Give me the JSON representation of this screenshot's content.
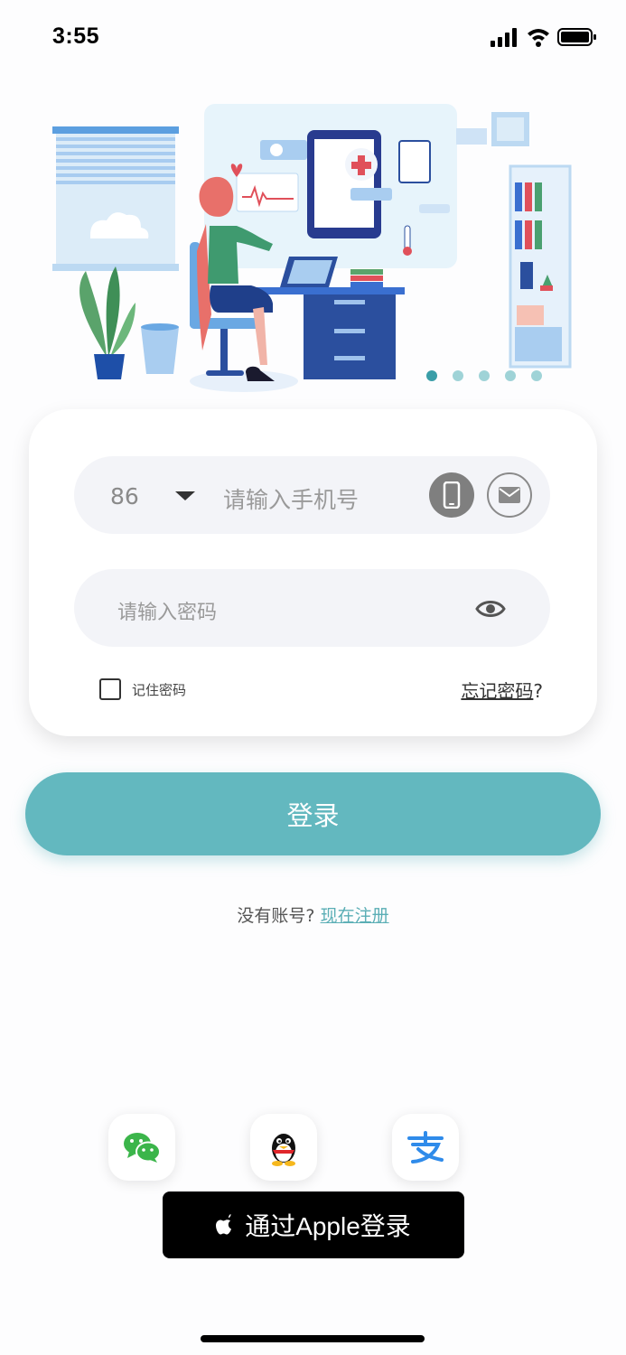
{
  "status_bar": {
    "time": "3:55",
    "icons": [
      "signal-icon",
      "wifi-icon",
      "battery-icon"
    ]
  },
  "hero": {
    "carousel_total": 5,
    "carousel_active": 1
  },
  "login_form": {
    "country_code": "86",
    "phone_placeholder": "请输入手机号",
    "password_placeholder": "请输入密码",
    "remember_label": "记住密码",
    "forgot_label": "忘记密码",
    "forgot_suffix": "?"
  },
  "login_button": "登录",
  "register": {
    "prompt": "没有账号?",
    "link": "现在注册"
  },
  "social": {
    "icons": [
      "wechat-icon",
      "qq-icon",
      "alipay-icon"
    ]
  },
  "apple_login": "通过Apple登录",
  "colors": {
    "accent": "#63b8bf",
    "link": "#5aaeb5",
    "field_bg": "#f3f4f8",
    "dot_active": "#3a9ea8",
    "dot": "#9fd3d7"
  }
}
